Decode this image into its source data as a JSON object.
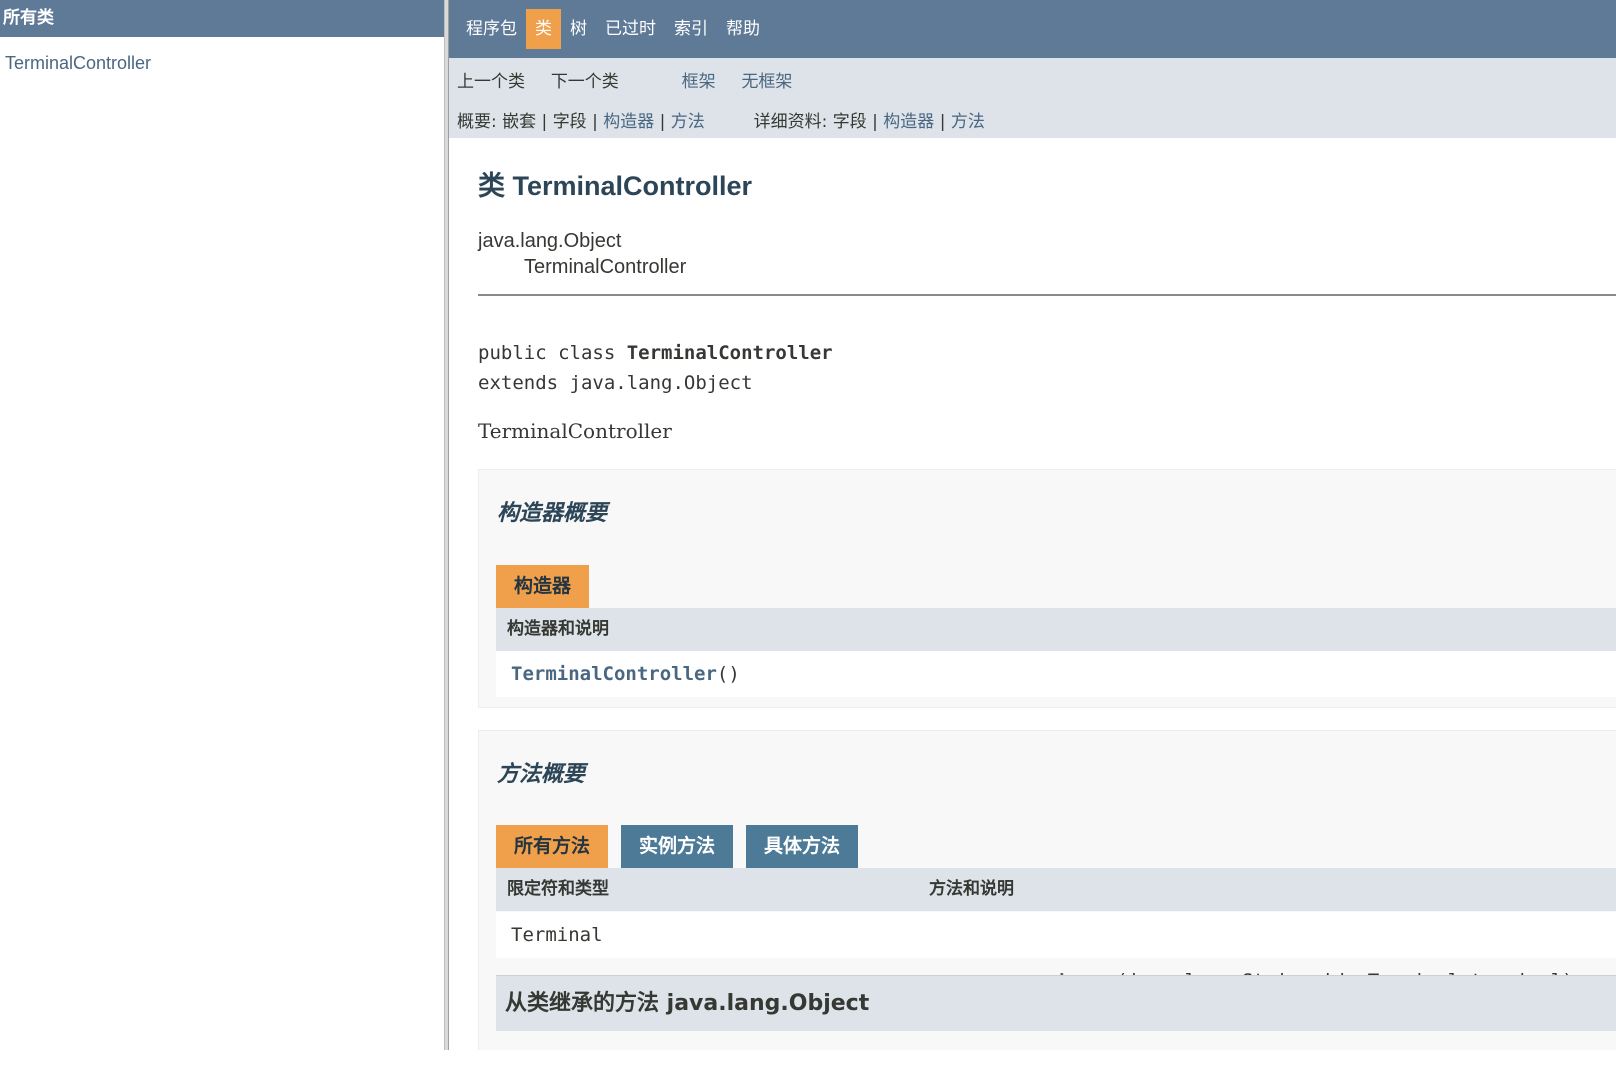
{
  "left": {
    "header": "所有类",
    "classes": [
      "TerminalController"
    ]
  },
  "topnav": {
    "items": [
      "程序包",
      "类",
      "树",
      "已过时",
      "索引",
      "帮助"
    ]
  },
  "subnav": {
    "prev_class": "上一个类",
    "next_class": "下一个类",
    "frames": "框架",
    "no_frames": "无框架",
    "summary_label": "概要:",
    "summary_nested": "嵌套",
    "summary_field": "字段",
    "summary_ctor": "构造器",
    "summary_method": "方法",
    "detail_label": "详细资料:",
    "detail_field": "字段",
    "detail_ctor": "构造器",
    "detail_method": "方法",
    "sep": "|"
  },
  "page": {
    "title": "类 TerminalController",
    "inherit_parent": "java.lang.Object",
    "inherit_child": "TerminalController",
    "decl_line1_prefix": "public class ",
    "decl_line1_name": "TerminalController",
    "decl_line2": "extends java.lang.Object",
    "description": "TerminalController"
  },
  "ctor_summary": {
    "title": "构造器概要",
    "tab": "构造器",
    "header": "构造器和说明",
    "row_name": "TerminalController",
    "row_params": "()"
  },
  "method_summary": {
    "title": "方法概要",
    "tabs": [
      "所有方法",
      "实例方法",
      "具体方法"
    ],
    "col_type": "限定符和类型",
    "col_method": "方法和说明",
    "rows": [
      {
        "type": "Terminal",
        "name": "change",
        "params": "(java.lang.String id, Terminal terminal)"
      }
    ],
    "inherited_title": "从类继承的方法 java.lang.Object"
  },
  "colors": {
    "nav_bar": "#5f7a97",
    "active_tab": "#f0a04a",
    "sub_bar": "#dee3e9",
    "link": "#4a6782"
  }
}
